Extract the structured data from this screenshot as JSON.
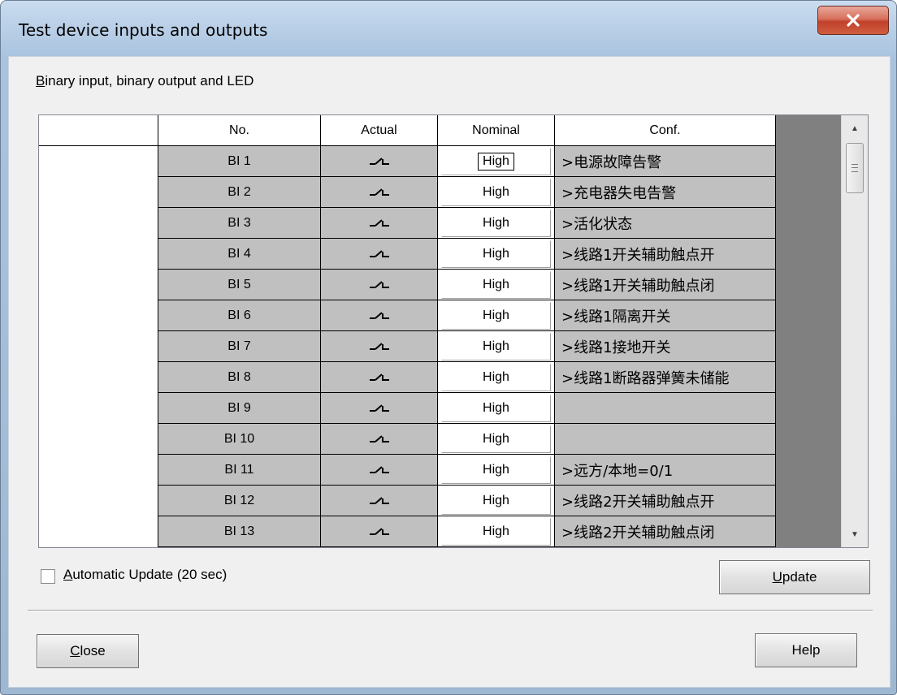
{
  "window": {
    "title": "Test device inputs and outputs",
    "close_glyph": "X"
  },
  "section_label": {
    "acc": "B",
    "rest": "inary input, binary output and LED"
  },
  "table": {
    "columns": [
      "No.",
      "Actual",
      "Nominal",
      "Conf."
    ],
    "actual_icon": "switch-open-icon",
    "rows": [
      {
        "no": "BI 1",
        "nominal": "High",
        "conf": ">电源故障告警"
      },
      {
        "no": "BI 2",
        "nominal": "High",
        "conf": ">充电器失电告警"
      },
      {
        "no": "BI 3",
        "nominal": "High",
        "conf": ">活化状态"
      },
      {
        "no": "BI 4",
        "nominal": "High",
        "conf": ">线路1开关辅助触点开"
      },
      {
        "no": "BI 5",
        "nominal": "High",
        "conf": ">线路1开关辅助触点闭"
      },
      {
        "no": "BI 6",
        "nominal": "High",
        "conf": ">线路1隔离开关"
      },
      {
        "no": "BI 7",
        "nominal": "High",
        "conf": ">线路1接地开关"
      },
      {
        "no": "BI 8",
        "nominal": "High",
        "conf": ">线路1断路器弹簧未储能"
      },
      {
        "no": "BI 9",
        "nominal": "High",
        "conf": ""
      },
      {
        "no": "BI 10",
        "nominal": "High",
        "conf": ""
      },
      {
        "no": "BI 11",
        "nominal": "High",
        "conf": ">远方/本地=0/1"
      },
      {
        "no": "BI 12",
        "nominal": "High",
        "conf": ">线路2开关辅助触点开"
      },
      {
        "no": "BI 13",
        "nominal": "High",
        "conf": ">线路2开关辅助触点闭"
      }
    ]
  },
  "auto_update": {
    "acc": "A",
    "rest": "utomatic Update (20 sec)",
    "checked": false
  },
  "buttons": {
    "update_acc": "U",
    "update_rest": "pdate",
    "close_acc": "C",
    "close_rest": "lose",
    "help": "Help"
  }
}
